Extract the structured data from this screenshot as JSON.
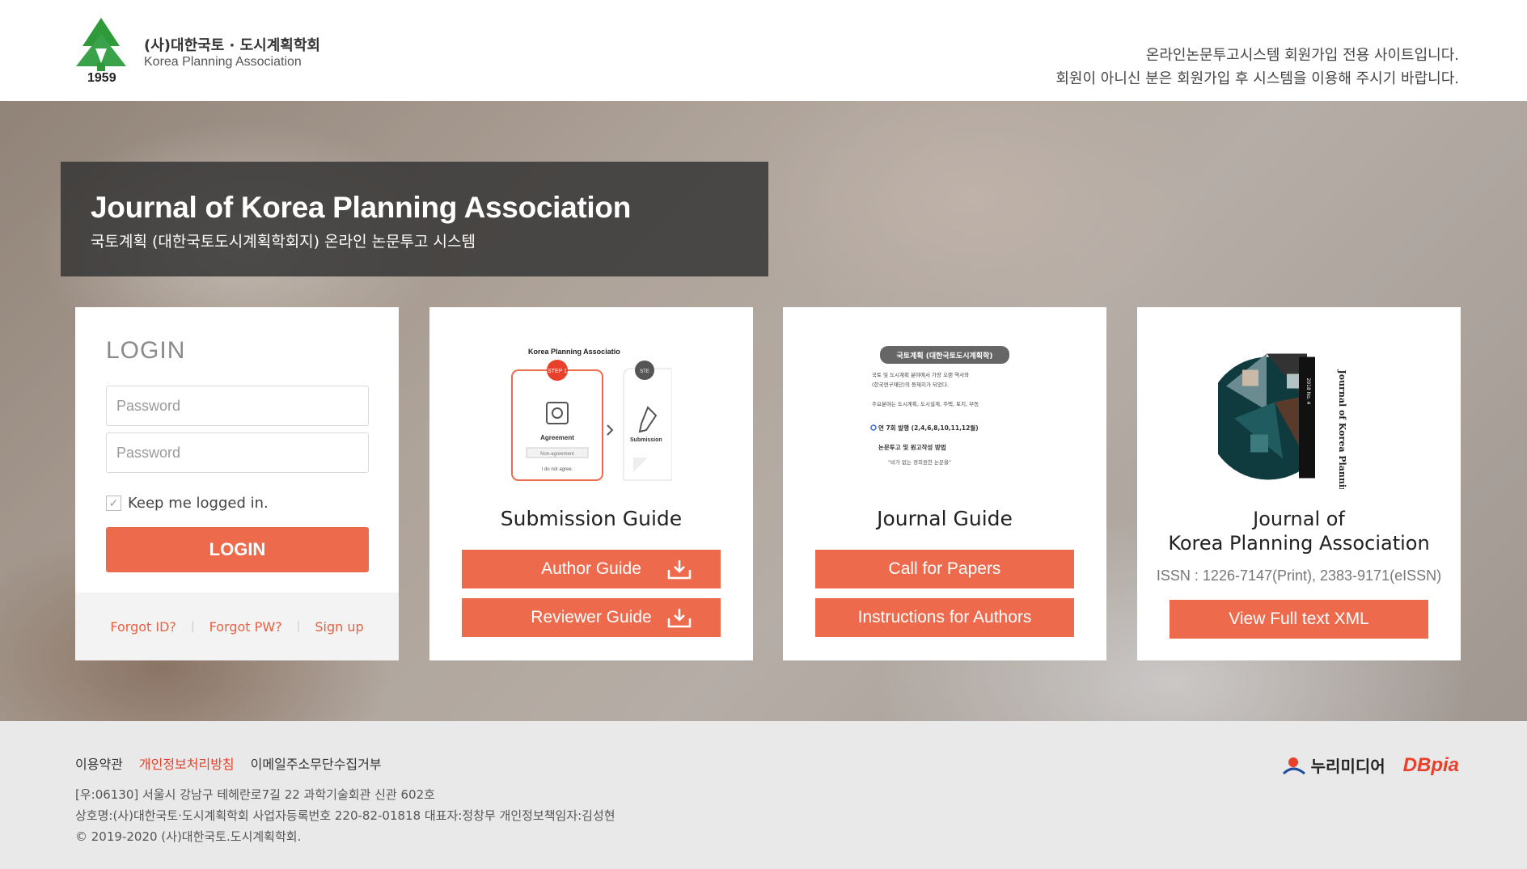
{
  "header": {
    "logo_ko": "(사)대한국토 · 도시계획학회",
    "logo_en": "Korea Planning Association",
    "logo_year": "1959",
    "notice_line1": "온라인논문투고시스템 회원가입 전용 사이트입니다.",
    "notice_line2": "회원이 아니신 분은 회원가입 후 시스템을 이용해 주시기 바랍니다."
  },
  "hero": {
    "title_en": "Journal of Korea Planning Association",
    "title_ko": "국토계획 (대한국토도시계획학회지) 온라인 논문투고 시스템"
  },
  "login": {
    "title": "LOGIN",
    "id_placeholder": "Password",
    "pw_placeholder": "Password",
    "keep_label": "Keep me logged in.",
    "button_label": "LOGIN",
    "forgot_id": "Forgot ID?",
    "forgot_pw": "Forgot PW?",
    "sign_up": "Sign up",
    "separator": "|"
  },
  "cards": {
    "submission": {
      "title": "Submission Guide",
      "btn1": "Author Guide",
      "btn2": "Reviewer Guide",
      "thumb_header": "Korea Planning Associatio",
      "thumb_step1": "STEP 1",
      "thumb_step2": "STE",
      "thumb_agreement": "Agreement",
      "thumb_nonagreement": "Non-agreement",
      "thumb_notagree": "I do not agree.",
      "thumb_submission": "Submission"
    },
    "journal": {
      "title": "Journal Guide",
      "btn1": "Call for Papers",
      "btn2": "Instructions for Authors",
      "thumb_header": "국토계획 (대한국토도시계획학)",
      "thumb_line1": "국토 및 도시계획 분야에서 가장 오랜 역사와",
      "thumb_line2": "(한국연구재단)의 등재지가 되었다.",
      "thumb_line3": "주요분야는 도시계획, 도시설계, 주택, 토지, 부동",
      "thumb_line4": "연 7회 발행 (2,4,6,8,10,11,12월)",
      "thumb_line5": "논문투고 및 원고작성 방법",
      "thumb_line6": "\"비가 없는 경희원한 논문을\""
    },
    "kpa": {
      "title_line1": "Journal of",
      "title_line2": "Korea Planning Association",
      "issn": "ISSN : 1226-7147(Print), 2383-9171(eISSN)",
      "btn": "View Full text XML",
      "thumb_cover_text": "Journal of Korea Planning As",
      "thumb_vol": "2018 No. 4"
    }
  },
  "footer": {
    "link_terms": "이용약관",
    "link_privacy": "개인정보처리방침",
    "link_email": "이메일주소무단수집거부",
    "address": "[우:06130] 서울시 강남구 테헤란로7길 22 과학기술회관 신관 602호",
    "company": "상호명:(사)대한국토·도시계획학회 사업자등록번호 220-82-01818 대표자:정창무 개인정보책임자:김성현",
    "copyright": "© 2019-2020 (사)대한국토.도시계획학회.",
    "nuri": "누리미디어",
    "dbpia": "DBpia"
  },
  "colors": {
    "accent": "#ee6a4d",
    "login_border": "#3aa24a",
    "logo_green": "#2e9a3a"
  }
}
